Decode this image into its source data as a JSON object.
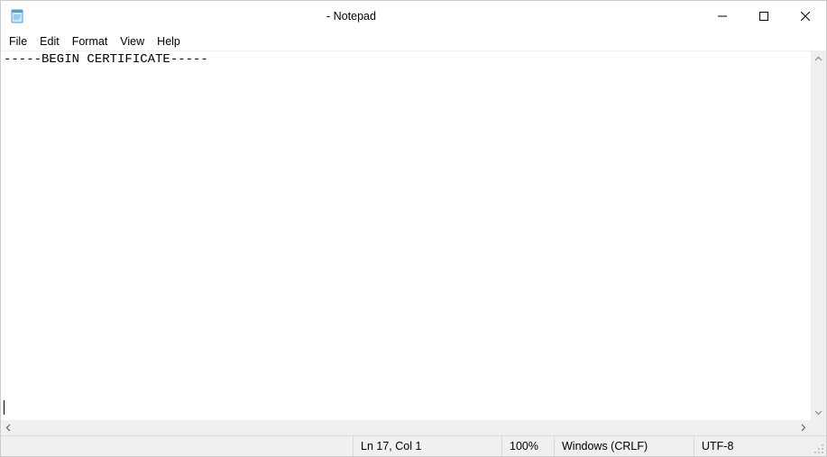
{
  "titlebar": {
    "title": " - Notepad"
  },
  "menu": {
    "file": "File",
    "edit": "Edit",
    "format": "Format",
    "view": "View",
    "help": "Help"
  },
  "editor": {
    "content": "-----BEGIN CERTIFICATE-----"
  },
  "status": {
    "position": "Ln 17, Col 1",
    "zoom": "100%",
    "line_ending": "Windows (CRLF)",
    "encoding": "UTF-8"
  }
}
